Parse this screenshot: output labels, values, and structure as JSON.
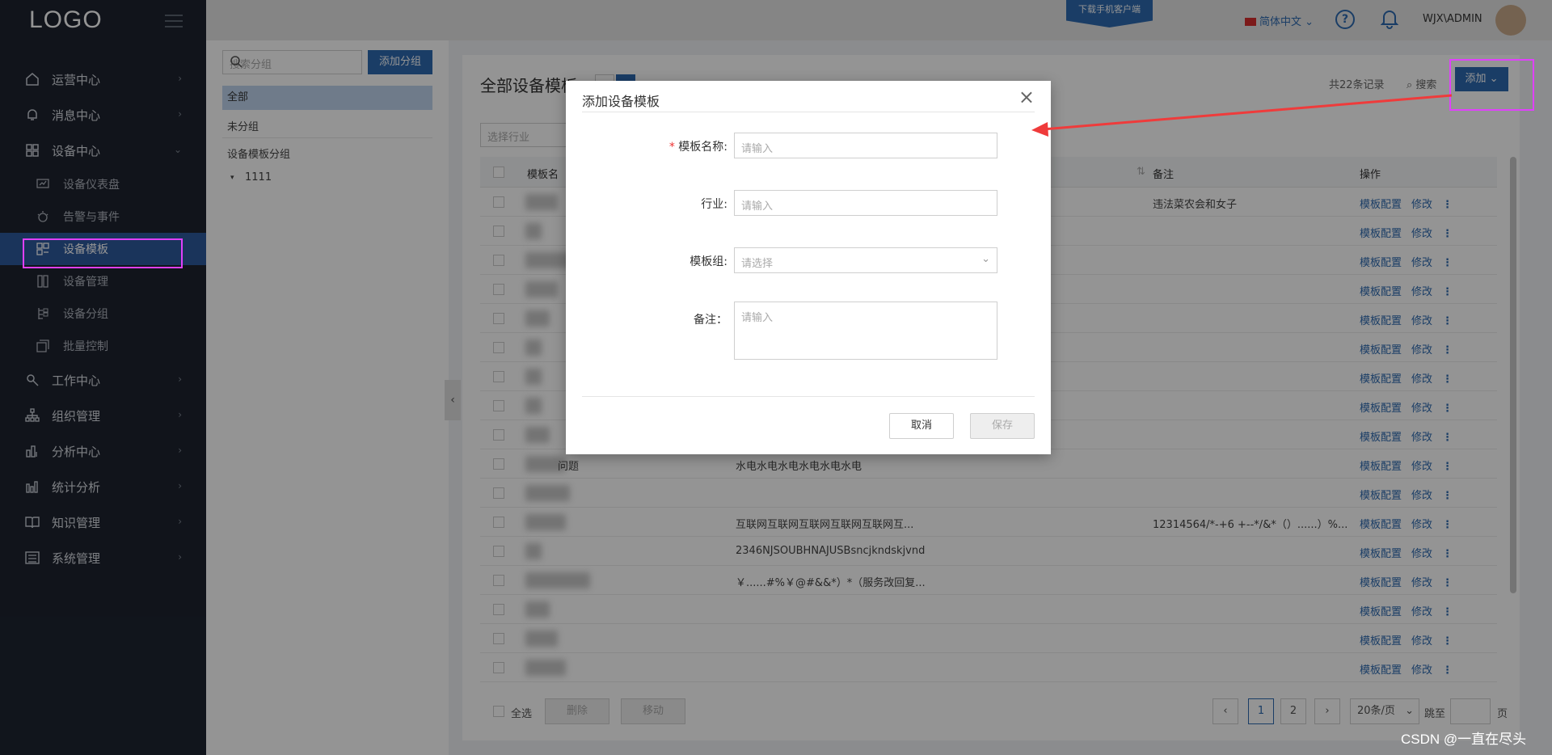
{
  "app": {
    "logo": "LOGO",
    "download": "下载手机客户端",
    "lang": "简体中文",
    "user": "WJX\\ADMIN"
  },
  "menu": [
    {
      "label": "运营中心",
      "icon": "home-icon"
    },
    {
      "label": "消息中心",
      "icon": "bell-icon"
    },
    {
      "label": "设备中心",
      "icon": "grid-icon"
    }
  ],
  "submenu": [
    {
      "label": "设备仪表盘",
      "icon": "dashboard-icon"
    },
    {
      "label": "告警与事件",
      "icon": "alarm-icon"
    },
    {
      "label": "设备模板",
      "icon": "template-icon"
    },
    {
      "label": "设备管理",
      "icon": "device-icon"
    },
    {
      "label": "设备分组",
      "icon": "group-icon"
    },
    {
      "label": "批量控制",
      "icon": "batch-icon"
    }
  ],
  "menu2": [
    {
      "label": "工作中心",
      "icon": "tools-icon"
    },
    {
      "label": "组织管理",
      "icon": "org-icon"
    },
    {
      "label": "分析中心",
      "icon": "analysis-icon"
    },
    {
      "label": "统计分析",
      "icon": "stats-icon"
    },
    {
      "label": "知识管理",
      "icon": "book-icon"
    },
    {
      "label": "系统管理",
      "icon": "settings-icon"
    }
  ],
  "groups": {
    "search_placeholder": "搜索分组",
    "add": "添加分组",
    "all": "全部",
    "ungrouped": "未分组",
    "template_group": "设备模板分组",
    "child": "1111"
  },
  "main": {
    "title": "全部设备模板",
    "count": "共22条记录",
    "search": "搜索",
    "add": "添加",
    "filter_placeholder": "选择行业"
  },
  "table": {
    "headers": {
      "name": "模板名",
      "note": "备注",
      "ops": "操作"
    },
    "ops": {
      "config": "模板配置",
      "edit": "修改",
      "more": "⋮"
    },
    "rows": [
      {
        "name": "",
        "desc": "",
        "note": "违法菜农会和女子"
      },
      {
        "name": "",
        "desc": "",
        "note": ""
      },
      {
        "name": "",
        "desc": "",
        "note": ""
      },
      {
        "name": "",
        "desc": "",
        "note": ""
      },
      {
        "name": "",
        "desc": "",
        "note": ""
      },
      {
        "name": "",
        "desc": "",
        "note": ""
      },
      {
        "name": "",
        "desc": "",
        "note": ""
      },
      {
        "name": "",
        "desc": "",
        "note": ""
      },
      {
        "name": "",
        "desc": "",
        "note": ""
      },
      {
        "name": "问题",
        "desc": "水电水电水电水电水电水电",
        "note": ""
      },
      {
        "name": "",
        "desc": "",
        "note": ""
      },
      {
        "name": "",
        "desc": "互联网互联网互联网互联网互联网互...",
        "note": "12314564/*-+6 +--*/&*（）......）%..."
      },
      {
        "name": "",
        "desc": "2346NJSOUBHNAJUSBsncjkndskjvnd",
        "note": ""
      },
      {
        "name": "",
        "desc": "￥......#%￥@#&&*）*（服务改回复...",
        "note": ""
      },
      {
        "name": "",
        "desc": "",
        "note": ""
      },
      {
        "name": "",
        "desc": "",
        "note": ""
      },
      {
        "name": "",
        "desc": "",
        "note": ""
      }
    ]
  },
  "footer": {
    "select_all": "全选",
    "delete": "删除",
    "move": "移动",
    "page1": "1",
    "page2": "2",
    "page_size": "20条/页",
    "jump": "跳至",
    "page_unit": "页"
  },
  "modal": {
    "title": "添加设备模板",
    "name_label": "模板名称:",
    "name_placeholder": "请输入",
    "industry_label": "行业:",
    "industry_placeholder": "请输入",
    "group_label": "模板组:",
    "group_placeholder": "请选择",
    "note_label": "备注：",
    "note_placeholder": "请输入",
    "cancel": "取消",
    "save": "保存",
    "required": "*"
  },
  "watermark": "CSDN @一直在尽头"
}
